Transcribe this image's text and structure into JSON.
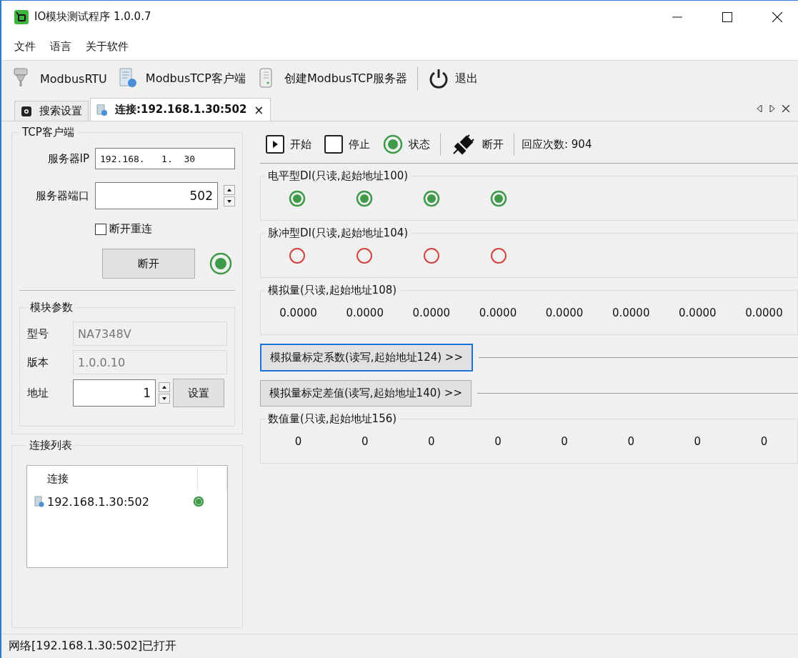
{
  "window": {
    "title": "IO模块测试程序 1.0.0.7"
  },
  "menu": [
    "文件",
    "语言",
    "关于软件"
  ],
  "toolbar": [
    {
      "kind": "serial",
      "label": "ModbusRTU"
    },
    {
      "kind": "client",
      "label": "ModbusTCP客户端"
    },
    {
      "kind": "server",
      "label": "创建ModbusTCP服务器"
    },
    {
      "kind": "exit",
      "label": "退出"
    }
  ],
  "tabs": [
    {
      "kind": "settings",
      "label": "搜索设置",
      "selected": false,
      "closable": false
    },
    {
      "kind": "connection",
      "label": "连接:192.168.1.30:502",
      "selected": true,
      "closable": true
    }
  ],
  "tab_close": "×",
  "tcp_client": {
    "title": "TCP客户端",
    "ip_label": "服务器IP",
    "ip_value": "192.168.   1.  30",
    "port_label": "服务器端口",
    "port_value": "502",
    "reconnect": {
      "label": "断开重连",
      "checked": false
    },
    "button": "断开",
    "connected": true
  },
  "module_params": {
    "title": "模块参数",
    "fields": [
      {
        "kind": "readonly",
        "label": "型号",
        "value": "NA7348V"
      },
      {
        "kind": "readonly",
        "label": "版本",
        "value": "1.0.0.10"
      },
      {
        "kind": "spin",
        "label": "地址",
        "value": "1",
        "button": "设置"
      }
    ]
  },
  "connection_list": {
    "title": "连接列表",
    "column": "连接",
    "rows": [
      {
        "address": "192.168.1.30:502",
        "connected": true
      }
    ]
  },
  "controls": [
    {
      "kind": "start",
      "label": "开始"
    },
    {
      "kind": "stop",
      "label": "停止"
    },
    {
      "kind": "status",
      "label": "状态",
      "on": true
    },
    {
      "kind": "disconnect",
      "label": "断开"
    }
  ],
  "response_count": "回应次数: 904",
  "sections": [
    {
      "kind": "lamps",
      "title": "电平型DI(只读,起始地址100)",
      "items": [
        {
          "on": true
        },
        {
          "on": true
        },
        {
          "on": true
        },
        {
          "on": true
        }
      ]
    },
    {
      "kind": "lamps",
      "title": "脉冲型DI(只读,起始地址104)",
      "items": [
        {
          "on": false
        },
        {
          "on": false
        },
        {
          "on": false
        },
        {
          "on": false
        }
      ]
    },
    {
      "kind": "values",
      "title": "模拟量(只读,起始地址108)",
      "items": [
        "0.0000",
        "0.0000",
        "0.0000",
        "0.0000",
        "0.0000",
        "0.0000",
        "0.0000",
        "0.0000"
      ]
    },
    {
      "kind": "expander",
      "label": "模拟量标定系数(读写,起始地址124) >>",
      "focused": true
    },
    {
      "kind": "expander",
      "label": "模拟量标定差值(读写,起始地址140) >>",
      "focused": false
    },
    {
      "kind": "values",
      "title": "数值量(只读,起始地址156)",
      "items": [
        "0",
        "0",
        "0",
        "0",
        "0",
        "0",
        "0",
        "0"
      ]
    }
  ],
  "status_bar": "网络[192.168.1.30:502]已打开"
}
